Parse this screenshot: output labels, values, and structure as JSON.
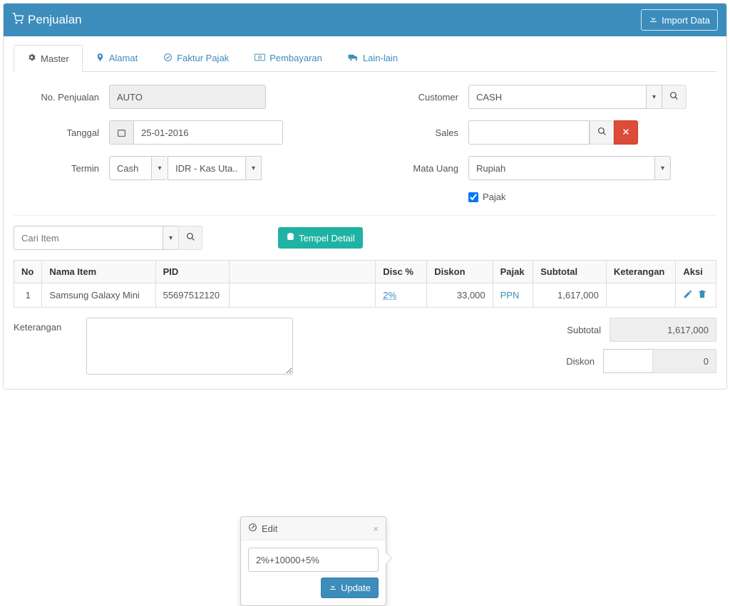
{
  "header": {
    "title": "Penjualan",
    "import_button": "Import Data"
  },
  "tabs": {
    "master": "Master",
    "alamat": "Alamat",
    "faktur": "Faktur Pajak",
    "pembayaran": "Pembayaran",
    "lain": "Lain-lain"
  },
  "form": {
    "no_label": "No. Penjualan",
    "no_value": "AUTO",
    "tanggal_label": "Tanggal",
    "tanggal_value": "25-01-2016",
    "termin_label": "Termin",
    "termin_cash": "Cash",
    "termin_account": "IDR - Kas Uta..",
    "customer_label": "Customer",
    "customer_value": "CASH",
    "sales_label": "Sales",
    "sales_value": "",
    "currency_label": "Mata Uang",
    "currency_value": "Rupiah",
    "pajak_label": "Pajak",
    "pajak_checked": true
  },
  "detail": {
    "search_placeholder": "Cari Item",
    "tempel_button": "Tempel Detail",
    "cols": {
      "no": "No",
      "nama": "Nama Item",
      "pid": "PID",
      "discp": "Disc %",
      "diskon": "Diskon",
      "pajak": "Pajak",
      "subtotal": "Subtotal",
      "ket": "Keterangan",
      "aksi": "Aksi"
    },
    "rows": [
      {
        "no": "1",
        "nama": "Samsung Galaxy Mini",
        "pid": "55697512120",
        "discp": "2%",
        "diskon": "33,000",
        "pajak": "PPN",
        "subtotal": "1,617,000",
        "ket": ""
      }
    ]
  },
  "popover": {
    "title": "Edit",
    "value": "2%+10000+5%",
    "update": "Update"
  },
  "footer": {
    "keterangan_label": "Keterangan",
    "subtotal_label": "Subtotal",
    "subtotal_value": "1,617,000",
    "diskon_label": "Diskon",
    "diskon_input": "",
    "diskon_value": "0"
  }
}
